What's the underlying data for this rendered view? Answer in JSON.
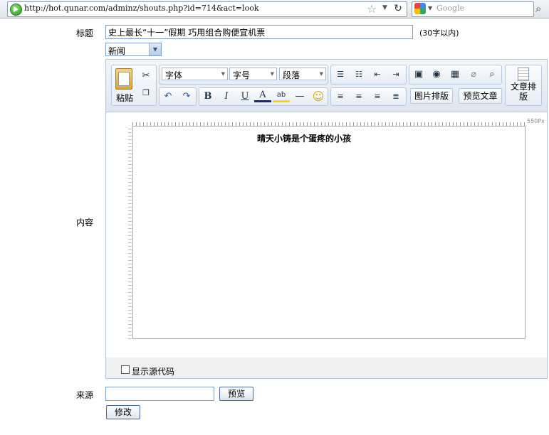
{
  "browser": {
    "url": "http://hot.qunar.com/adminz/shouts.php?id=714&act=look",
    "search_placeholder": "Google"
  },
  "form": {
    "title_label": "标题",
    "title_value": "史上最长“十一”假期 巧用组合购便宜机票",
    "title_hint": "(30字以内)",
    "category_selected": "新闻",
    "content_label": "内容",
    "source_label": "来源",
    "source_value": "",
    "preview_button": "预览",
    "modify_button": "修改"
  },
  "editor": {
    "paste_label": "粘贴",
    "font_dropdown": "字体",
    "size_dropdown": "字号",
    "paragraph_dropdown": "段落",
    "image_layout_button": "图片排版",
    "preview_article_button": "预览文章",
    "article_layout_button": "文章排版",
    "ruler_label": "550Px",
    "content_text": "晴天小铸是个蛋疼的小孩",
    "show_source_label": "显示源代码"
  }
}
